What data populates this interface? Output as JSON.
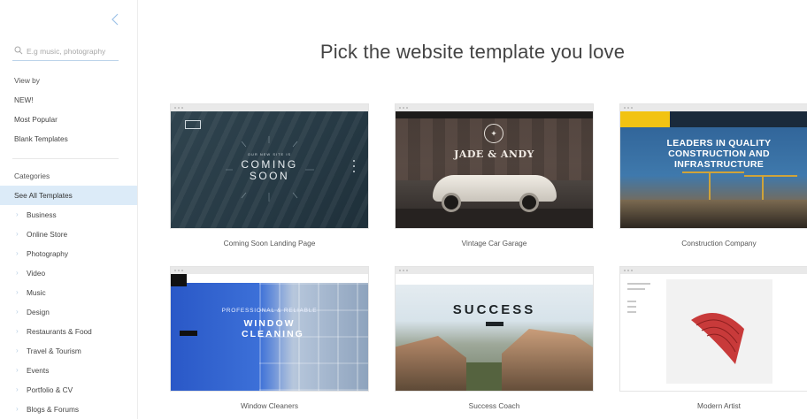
{
  "sidebar": {
    "search": {
      "placeholder": "E.g music, photography"
    },
    "view_by": {
      "label": "View by",
      "items": [
        {
          "label": "NEW!"
        },
        {
          "label": "Most Popular"
        },
        {
          "label": "Blank Templates"
        }
      ]
    },
    "categories": {
      "label": "Categories",
      "selected": "See All Templates",
      "items": [
        {
          "label": "Business"
        },
        {
          "label": "Online Store"
        },
        {
          "label": "Photography"
        },
        {
          "label": "Video"
        },
        {
          "label": "Music"
        },
        {
          "label": "Design"
        },
        {
          "label": "Restaurants & Food"
        },
        {
          "label": "Travel & Tourism"
        },
        {
          "label": "Events"
        },
        {
          "label": "Portfolio & CV"
        },
        {
          "label": "Blogs & Forums"
        }
      ]
    }
  },
  "main": {
    "heading": "Pick the website template you love",
    "templates": [
      {
        "name": "Coming Soon Landing Page",
        "hero_text": "COMING SOON",
        "kicker": "OUR NEW SITE IS"
      },
      {
        "name": "Vintage Car Garage",
        "hero_text": "JADE & ANDY"
      },
      {
        "name": "Construction Company",
        "hero_text": "LEADERS IN QUALITY CONSTRUCTION AND INFRASTRUCTURE"
      },
      {
        "name": "Window Cleaners",
        "hero_text": "WINDOW CLEANING",
        "kicker": "PROFESSIONAL & RELIABLE"
      },
      {
        "name": "Success Coach",
        "hero_text": "SUCCESS"
      },
      {
        "name": "Modern Artist"
      }
    ]
  },
  "colors": {
    "accent": "#dcebf8",
    "chevron": "#b8cfe4",
    "search_underline": "#bcd4ea"
  },
  "icons": {
    "collapse": "chevron-left-icon",
    "search": "search-icon",
    "category_chevron": "chevron-right-icon"
  }
}
